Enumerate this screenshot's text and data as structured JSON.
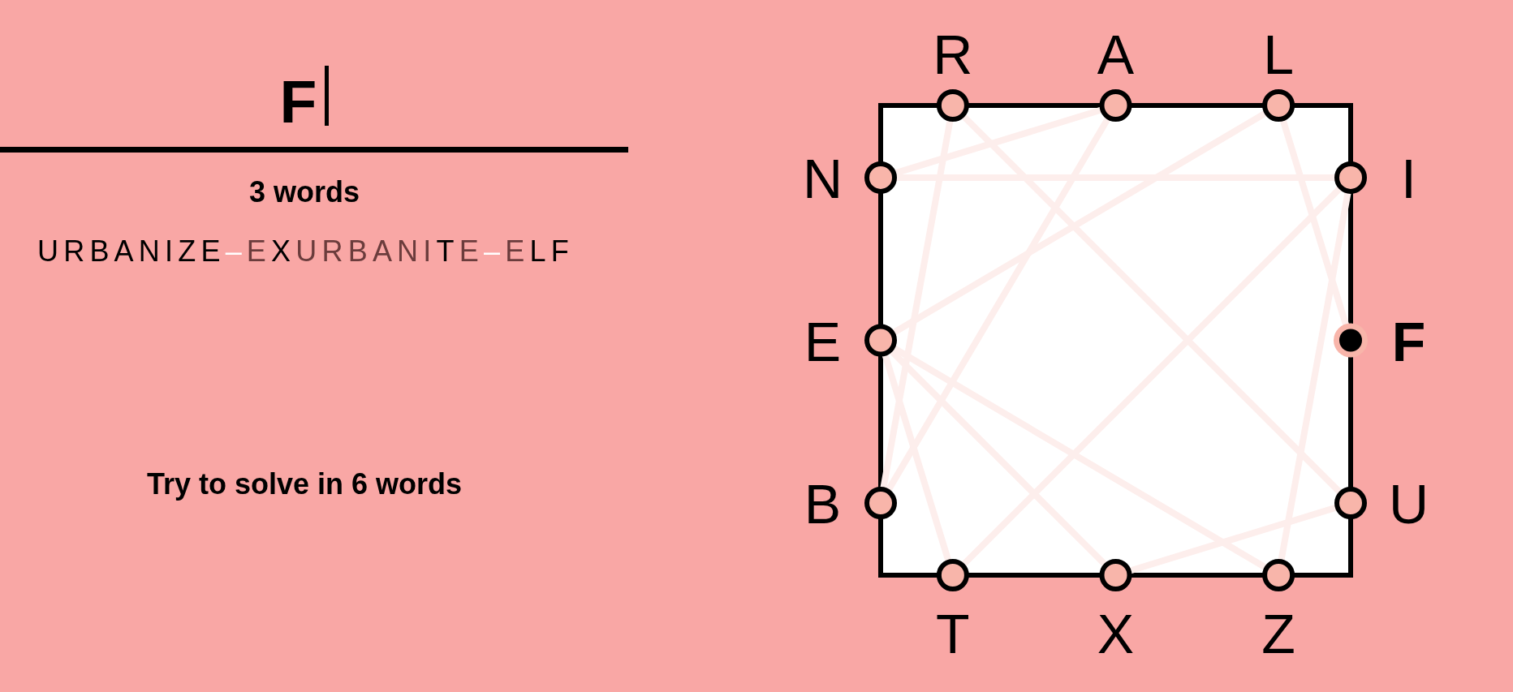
{
  "entry": {
    "value": "F"
  },
  "word_count": "3 words",
  "played_words": [
    {
      "word": "URBANIZE"
    },
    {
      "joiner": "–",
      "word": "EXURBANITE"
    },
    {
      "joiner": "–",
      "word": "ELF"
    }
  ],
  "goal": "Try to solve in 6 words",
  "board": {
    "top": [
      {
        "letter": "R",
        "used": true,
        "current": false
      },
      {
        "letter": "A",
        "used": true,
        "current": false
      },
      {
        "letter": "L",
        "used": true,
        "current": false
      }
    ],
    "left": [
      {
        "letter": "N",
        "used": true,
        "current": false
      },
      {
        "letter": "E",
        "used": true,
        "current": false
      },
      {
        "letter": "B",
        "used": true,
        "current": false
      }
    ],
    "right": [
      {
        "letter": "I",
        "used": true,
        "current": false
      },
      {
        "letter": "F",
        "used": true,
        "current": true
      },
      {
        "letter": "U",
        "used": true,
        "current": false
      }
    ],
    "bottom": [
      {
        "letter": "T",
        "used": true,
        "current": false
      },
      {
        "letter": "X",
        "used": true,
        "current": false
      },
      {
        "letter": "Z",
        "used": true,
        "current": false
      }
    ]
  }
}
